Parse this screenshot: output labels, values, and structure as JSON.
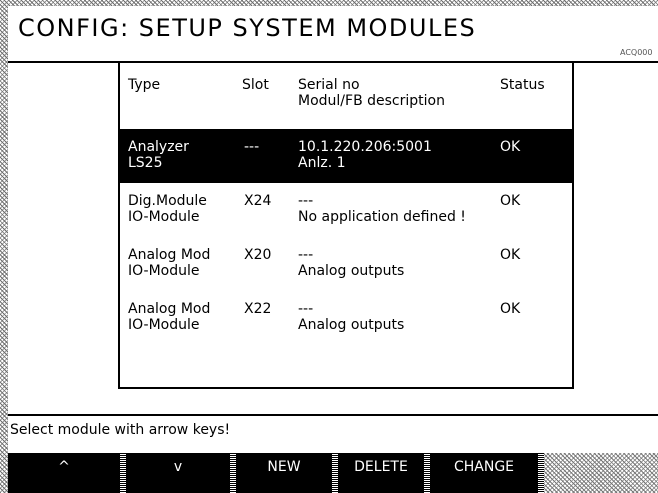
{
  "title": "CONFIG: SETUP SYSTEM MODULES",
  "screen_code": "ACQ000",
  "columns": {
    "type": "Type",
    "slot": "Slot",
    "serial_line1": "Serial no",
    "serial_line2": "Modul/FB description",
    "status": "Status"
  },
  "rows": [
    {
      "type_line1": "Analyzer",
      "type_line2": "LS25",
      "slot": "---",
      "serial_line1": "10.1.220.206:5001",
      "serial_line2": "Anlz. 1",
      "status": "OK",
      "selected": true
    },
    {
      "type_line1": "Dig.Module",
      "type_line2": "IO-Module",
      "slot": "X24",
      "serial_line1": "---",
      "serial_line2": "No application defined !",
      "status": "OK",
      "selected": false
    },
    {
      "type_line1": "Analog Mod",
      "type_line2": "IO-Module",
      "slot": "X20",
      "serial_line1": "---",
      "serial_line2": "Analog outputs",
      "status": "OK",
      "selected": false
    },
    {
      "type_line1": "Analog Mod",
      "type_line2": "IO-Module",
      "slot": "X22",
      "serial_line1": "---",
      "serial_line2": "Analog outputs",
      "status": "OK",
      "selected": false
    }
  ],
  "status_message": "Select module with arrow keys!",
  "softkeys": {
    "up": "^",
    "down": "v",
    "new": "NEW",
    "delete": "DELETE",
    "change": "CHANGE"
  },
  "colors": {
    "background": "#ffffff",
    "selection": "#000000",
    "softkey_bar": "#000000"
  }
}
